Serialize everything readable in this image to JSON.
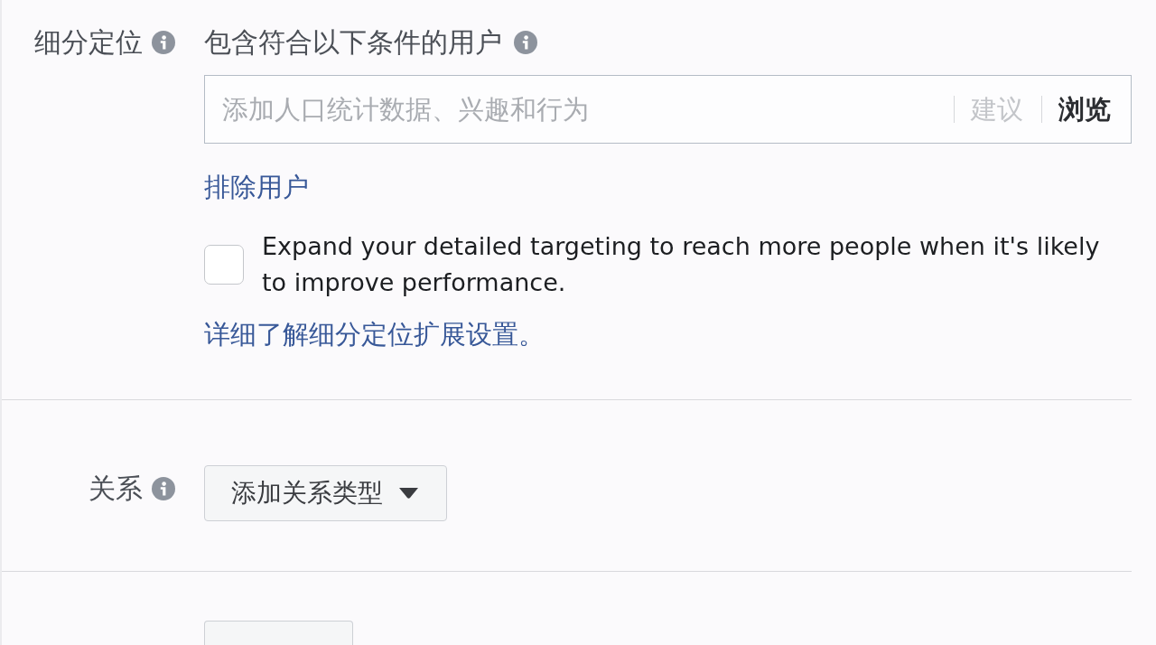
{
  "detailed_targeting": {
    "label": "细分定位",
    "include": {
      "heading": "包含符合以下条件的用户",
      "search": {
        "placeholder": "添加人口统计数据、兴趣和行为",
        "actions": [
          {
            "label": "建议",
            "disabled": true
          },
          {
            "label": "浏览",
            "disabled": false
          }
        ]
      }
    },
    "exclude_link": "排除用户",
    "expansion": {
      "checked": false,
      "label": "Expand your detailed targeting to reach more people when it's likely to improve performance."
    },
    "learn_more_link": "详细了解细分定位扩展设置。"
  },
  "connections": {
    "label": "关系",
    "dropdown": {
      "label": "添加关系类型"
    }
  }
}
